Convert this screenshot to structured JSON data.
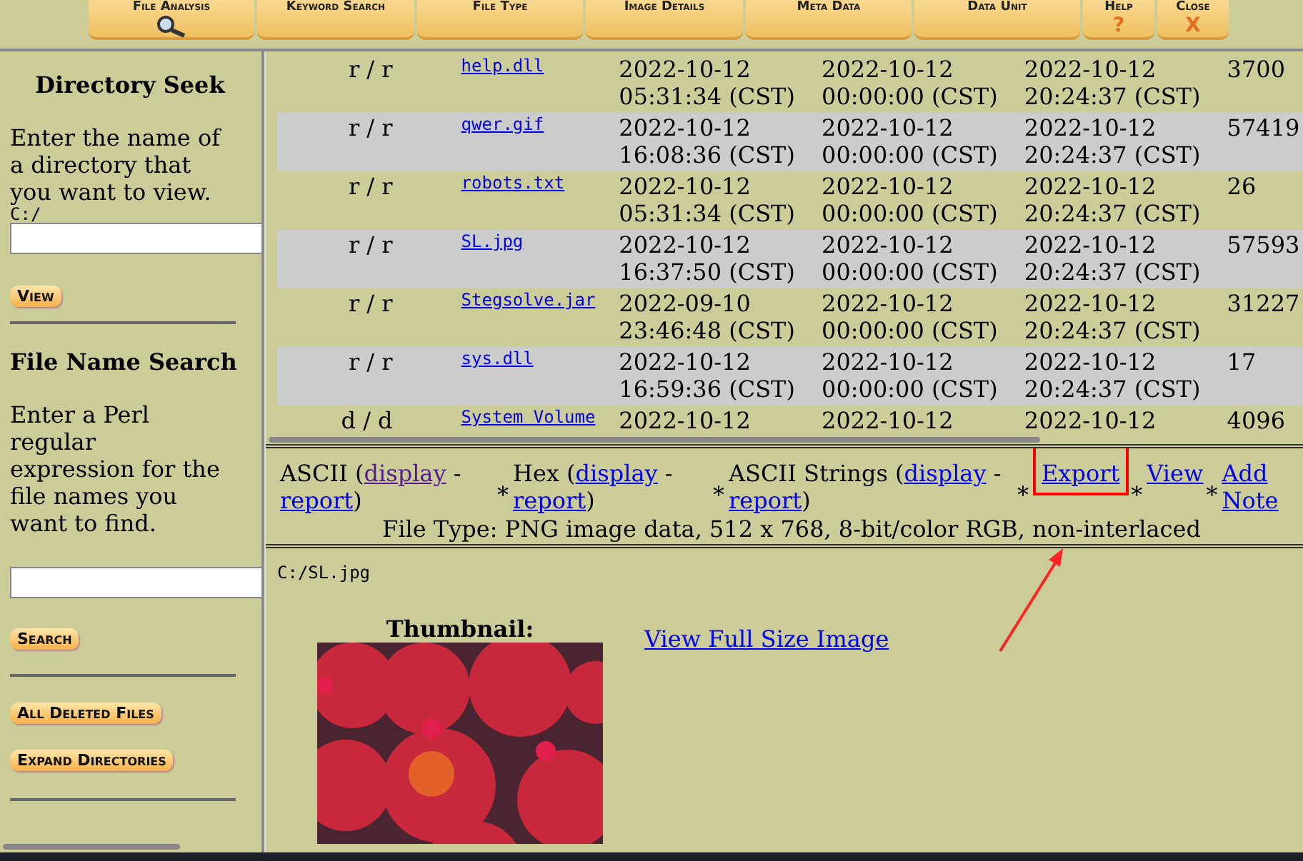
{
  "tabs": [
    {
      "label": "File Analysis",
      "selected": true
    },
    {
      "label": "Keyword Search",
      "selected": false
    },
    {
      "label": "File Type",
      "selected": false
    },
    {
      "label": "Image Details",
      "selected": false
    },
    {
      "label": "Meta Data",
      "selected": false
    },
    {
      "label": "Data Unit",
      "selected": false
    },
    {
      "label": "Help",
      "selected": false,
      "glyph": "?"
    },
    {
      "label": "Close",
      "selected": false,
      "glyph": "X"
    }
  ],
  "sidebar": {
    "directory_seek": {
      "title": "Directory Seek",
      "prompt": "Enter the name of a directory that you want to view.",
      "path": "C:/",
      "button": "View"
    },
    "file_name_search": {
      "title": "File Name Search",
      "prompt": "Enter a Perl regular expression for the file names you want to find.",
      "button": "Search"
    },
    "buttons": [
      "All Deleted Files",
      "Expand Directories"
    ]
  },
  "file_list": {
    "rows": [
      {
        "type": "r / r",
        "name": "help.dll",
        "written": [
          "2022-10-12",
          "05:31:34 (CST)"
        ],
        "accessed": [
          "2022-10-12",
          "00:00:00 (CST)"
        ],
        "changed": [
          "2022-10-12",
          "20:24:37 (CST)"
        ],
        "size": "3700"
      },
      {
        "type": "r / r",
        "name": "qwer.gif",
        "written": [
          "2022-10-12",
          "16:08:36 (CST)"
        ],
        "accessed": [
          "2022-10-12",
          "00:00:00 (CST)"
        ],
        "changed": [
          "2022-10-12",
          "20:24:37 (CST)"
        ],
        "size": "57419"
      },
      {
        "type": "r / r",
        "name": "robots.txt",
        "written": [
          "2022-10-12",
          "05:31:34 (CST)"
        ],
        "accessed": [
          "2022-10-12",
          "00:00:00 (CST)"
        ],
        "changed": [
          "2022-10-12",
          "20:24:37 (CST)"
        ],
        "size": "26"
      },
      {
        "type": "r / r",
        "name": "SL.jpg",
        "written": [
          "2022-10-12",
          "16:37:50 (CST)"
        ],
        "accessed": [
          "2022-10-12",
          "00:00:00 (CST)"
        ],
        "changed": [
          "2022-10-12",
          "20:24:37 (CST)"
        ],
        "size": "57593"
      },
      {
        "type": "r / r",
        "name": "Stegsolve.jar",
        "written": [
          "2022-09-10",
          "23:46:48 (CST)"
        ],
        "accessed": [
          "2022-10-12",
          "00:00:00 (CST)"
        ],
        "changed": [
          "2022-10-12",
          "20:24:37 (CST)"
        ],
        "size": "31227"
      },
      {
        "type": "r / r",
        "name": "sys.dll",
        "written": [
          "2022-10-12",
          "16:59:36 (CST)"
        ],
        "accessed": [
          "2022-10-12",
          "00:00:00 (CST)"
        ],
        "changed": [
          "2022-10-12",
          "20:24:37 (CST)"
        ],
        "size": "17"
      },
      {
        "type": "d / d",
        "name": "System Volume",
        "written": [
          "2022-10-12"
        ],
        "accessed": [
          "2022-10-12"
        ],
        "changed": [
          "2022-10-12"
        ],
        "size": "4096"
      }
    ]
  },
  "actions": {
    "views": [
      {
        "label": "ASCII",
        "links": [
          {
            "text": "display",
            "visited": true
          },
          {
            "text": "report",
            "visited": false
          }
        ]
      },
      {
        "label": "Hex",
        "links": [
          {
            "text": "display",
            "visited": false
          },
          {
            "text": "report",
            "visited": false
          }
        ]
      },
      {
        "label": "ASCII Strings",
        "links": [
          {
            "text": "display",
            "visited": false
          },
          {
            "text": "report",
            "visited": false
          }
        ]
      }
    ],
    "links": [
      {
        "text": "Export",
        "highlighted": true
      },
      {
        "text": "View",
        "highlighted": false
      },
      {
        "text": "Add Note",
        "highlighted": false
      }
    ],
    "separator": "*",
    "open_paren": "(",
    "dash": "-",
    "close_paren": ")",
    "file_type": "File Type: PNG image data, 512 x 768, 8-bit/color RGB, non-interlaced"
  },
  "content": {
    "path": "C:/SL.jpg",
    "thumbnail_label": "Thumbnail:",
    "full_size_link": "View Full Size Image"
  }
}
